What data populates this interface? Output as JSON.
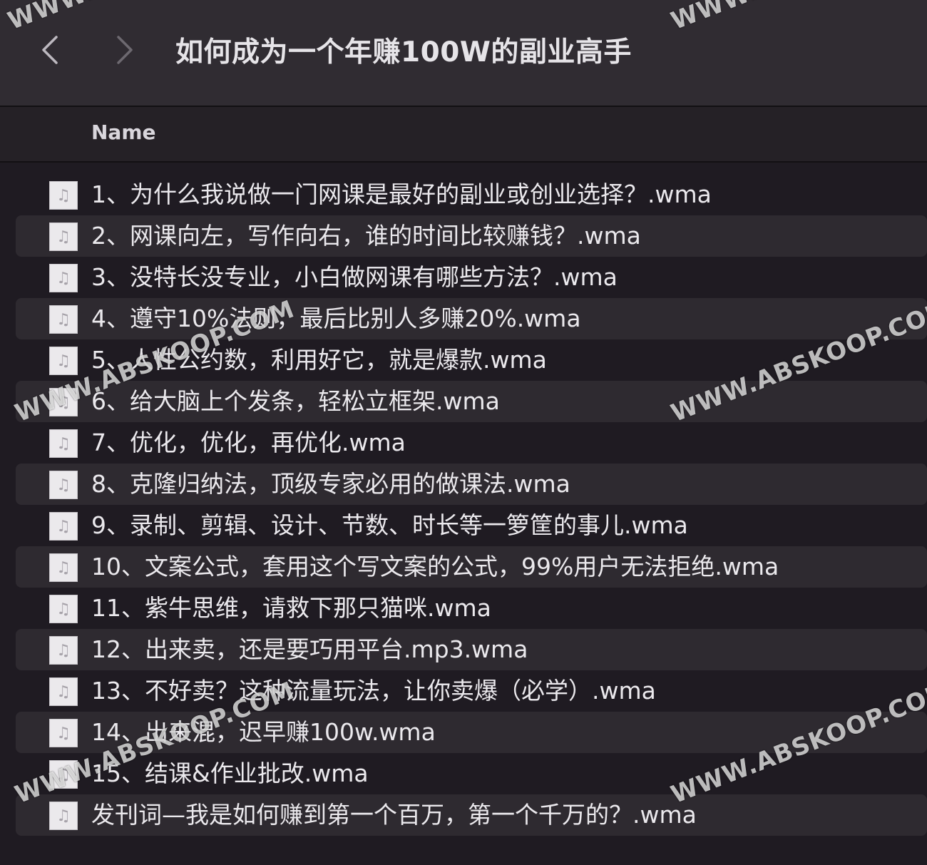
{
  "window": {
    "title": "如何成为一个年赚100W的副业高手",
    "back_icon": "chevron-left-icon",
    "forward_icon": "chevron-right-icon"
  },
  "header": {
    "name_column": "Name"
  },
  "files": [
    {
      "name": "1、为什么我说做一门网课是最好的副业或创业选择？.wma",
      "icon": "audio-file-icon"
    },
    {
      "name": "2、网课向左，写作向右，谁的时间比较赚钱？.wma",
      "icon": "audio-file-icon"
    },
    {
      "name": "3、没特长没专业，小白做网课有哪些方法？.wma",
      "icon": "audio-file-icon"
    },
    {
      "name": "4、遵守10%法则，最后比别人多赚20%.wma",
      "icon": "audio-file-icon"
    },
    {
      "name": "5、人性公约数，利用好它，就是爆款.wma",
      "icon": "audio-file-icon"
    },
    {
      "name": "6、给大脑上个发条，轻松立框架.wma",
      "icon": "audio-file-icon"
    },
    {
      "name": "7、优化，优化，再优化.wma",
      "icon": "audio-file-icon"
    },
    {
      "name": "8、克隆归纳法，顶级专家必用的做课法.wma",
      "icon": "audio-file-icon"
    },
    {
      "name": "9、录制、剪辑、设计、节数、时长等一箩筐的事儿.wma",
      "icon": "audio-file-icon"
    },
    {
      "name": "10、文案公式，套用这个写文案的公式，99%用户无法拒绝.wma",
      "icon": "audio-file-icon"
    },
    {
      "name": "11、紫牛思维，请救下那只猫咪.wma",
      "icon": "audio-file-icon"
    },
    {
      "name": "12、出来卖，还是要巧用平台.mp3.wma",
      "icon": "audio-file-icon"
    },
    {
      "name": "13、不好卖？这种流量玩法，让你卖爆（必学）.wma",
      "icon": "audio-file-icon"
    },
    {
      "name": "14、出来混，迟早赚100w.wma",
      "icon": "audio-file-icon"
    },
    {
      "name": "15、结课&作业批改.wma",
      "icon": "audio-file-icon"
    },
    {
      "name": "发刊词—我是如何赚到第一个百万，第一个千万的？.wma",
      "icon": "audio-file-icon"
    }
  ],
  "watermark": {
    "text": "WWW.ABSKOOP.COM"
  },
  "colors": {
    "background": "#1f1b22",
    "titlebar": "#302c32",
    "alt_row": "#2e2a30",
    "text": "#ebe9ed"
  }
}
